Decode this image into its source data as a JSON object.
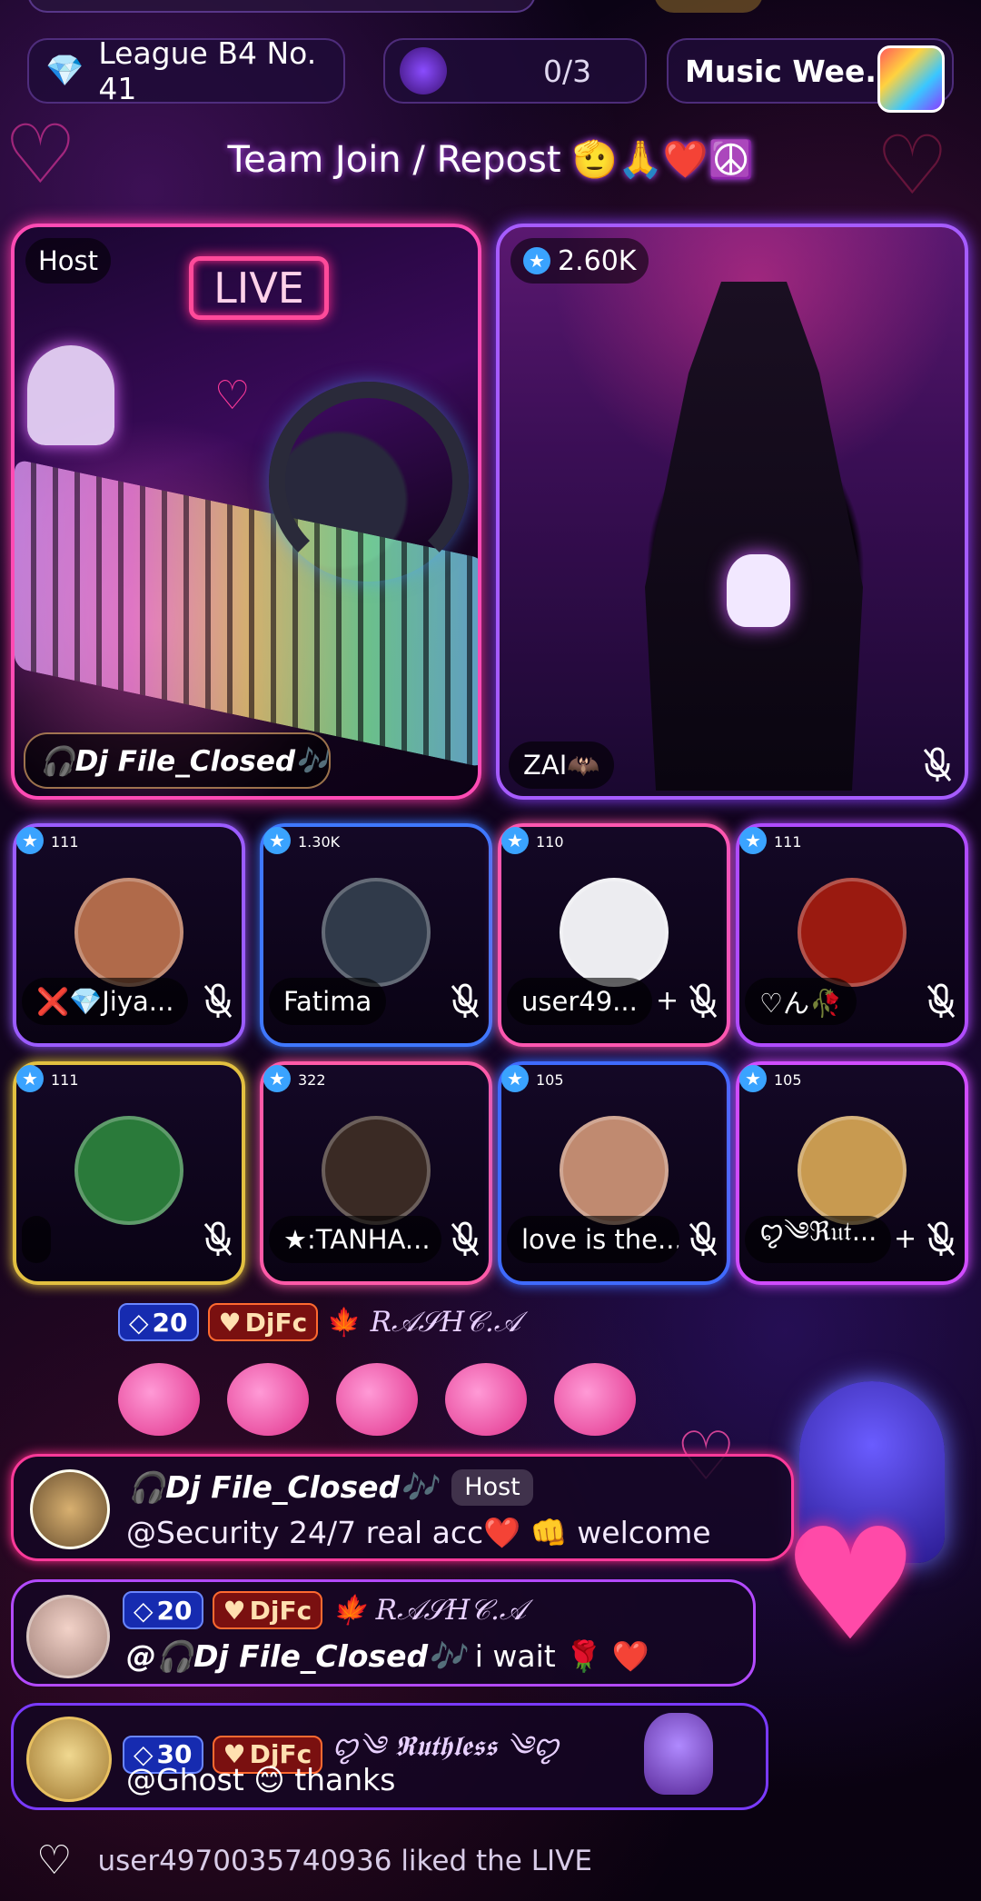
{
  "top_bar": {
    "league_label": "League B4 No. 41",
    "challenge_count": "0/3",
    "music_label": "Music Wee..."
  },
  "room_title": "Team Join / Repost 🫡🙏❤️☮️",
  "host_seat": {
    "tag": "Host",
    "live_badge": "LIVE",
    "name": "🎧Dj File_Closed🎶"
  },
  "cohost_seat": {
    "score": "2.60K",
    "name": "ZAI🦇"
  },
  "guest_seats": [
    {
      "score": "111",
      "name": "❌💎Jiya...",
      "border": "#9b5cff",
      "avatar": "#b06a4a"
    },
    {
      "score": "1.30K",
      "name": "Fatima",
      "border": "#3f78ff",
      "avatar": "#303a4a"
    },
    {
      "score": "110",
      "name": "user49...",
      "border": "#ff57b0",
      "avatar": "#ececf0",
      "add": "+"
    },
    {
      "score": "111",
      "name": "♡ん🥀",
      "border": "#b04cff",
      "avatar": "#9a1a10"
    },
    {
      "score": "111",
      "name": "",
      "border": "#e2c040",
      "avatar": "#2a7a3a"
    },
    {
      "score": "322",
      "name": "★:TANHA...",
      "border": "#ff5aa8",
      "avatar": "#3a2a24"
    },
    {
      "score": "105",
      "name": "love is the...",
      "border": "#3f6bff",
      "avatar": "#c08a70"
    },
    {
      "score": "105",
      "name": "ꨄ︎༄ℜ𝔲𝔱...",
      "border": "#d04cff",
      "avatar": "#c89a50",
      "add": "+"
    }
  ],
  "gift_row": {
    "diamond_level": "20",
    "fan_badge": "DjFc",
    "sender": "𝑅𝒜𝒮𝐻𝒞.𝒜"
  },
  "chat": [
    {
      "level": "",
      "badge": "",
      "name": "🎧Dj File_Closed🎶",
      "role": "Host",
      "message": "@Security 24/7 real acc❤️ 👊 welcome"
    },
    {
      "level": "20",
      "badge": "DjFc",
      "name": "🍁 𝑅𝒜𝒮𝐻𝒞.𝒜",
      "role": "",
      "message_mention": "@🎧Dj File_Closed🎶",
      "message": " i wait 🌹 ❤️"
    },
    {
      "level": "30",
      "badge": "DjFc",
      "name": "ꨄ︎༄ 𝕽𝖚𝖙𝖍𝖑𝖊𝖘𝖘 ༄ꨄ︎",
      "role": "",
      "message": "@Ghost 😊 thanks"
    }
  ],
  "activity": "user4970035740936 liked the LIVE"
}
